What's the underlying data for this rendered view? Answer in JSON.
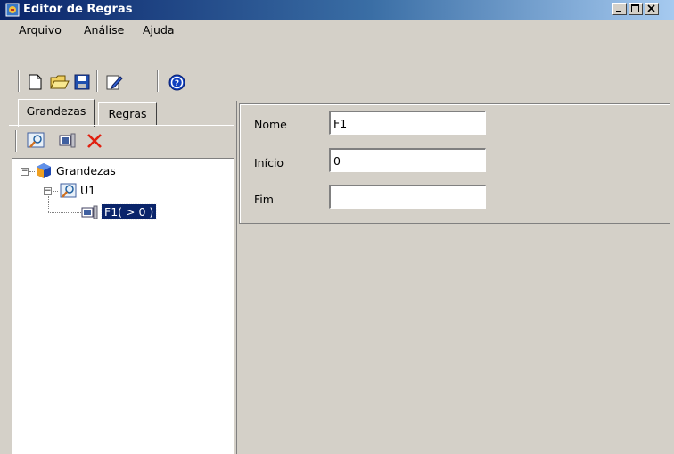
{
  "window": {
    "title": "Editor de Regras",
    "controls": [
      "minimize",
      "maximize",
      "close"
    ]
  },
  "menu": {
    "items": [
      "Arquivo",
      "Análise",
      "Ajuda"
    ]
  },
  "toolbar": {
    "buttons": [
      "new-file-icon",
      "open-folder-icon",
      "save-icon",
      "edit-icon",
      "help-icon"
    ]
  },
  "tabs": {
    "items": [
      "Grandezas",
      "Regras"
    ],
    "active": "Grandezas"
  },
  "tree_toolbar": {
    "buttons": [
      "add-quantity-icon",
      "add-range-icon",
      "delete-icon"
    ]
  },
  "tree": {
    "root": "Grandezas",
    "child": "U1",
    "leaf": "F1( > 0 )"
  },
  "properties": {
    "fields": [
      {
        "label": "Nome",
        "value": "F1"
      },
      {
        "label": "Início",
        "value": "0"
      },
      {
        "label": "Fim",
        "value": ""
      }
    ]
  }
}
